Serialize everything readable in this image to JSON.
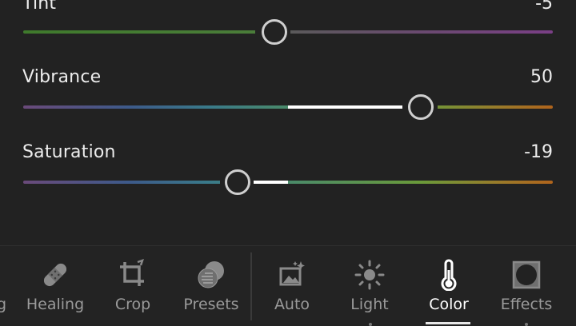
{
  "sliders": [
    {
      "label": "Tint",
      "value": "-5",
      "level": -5,
      "range": [
        -100,
        100
      ]
    },
    {
      "label": "Vibrance",
      "value": "50",
      "level": 50,
      "range": [
        -100,
        100
      ]
    },
    {
      "label": "Saturation",
      "value": "-19",
      "level": -19,
      "range": [
        -100,
        100
      ]
    }
  ],
  "toolbar": {
    "partial_label": "g",
    "left_tools": [
      {
        "label": "Healing",
        "icon": "bandage-icon"
      },
      {
        "label": "Crop",
        "icon": "crop-icon"
      },
      {
        "label": "Presets",
        "icon": "presets-icon"
      }
    ],
    "right_tools": [
      {
        "label": "Auto",
        "icon": "auto-enhance-icon"
      },
      {
        "label": "Light",
        "icon": "sun-icon"
      },
      {
        "label": "Color",
        "icon": "thermometer-icon",
        "active": true
      },
      {
        "label": "Effects",
        "icon": "effects-vignette-icon"
      }
    ]
  },
  "colors": {
    "background": "#222222",
    "active": "#ffffff",
    "inactive": "#9a9a9a",
    "thumb_border": "#cfcfcf"
  }
}
